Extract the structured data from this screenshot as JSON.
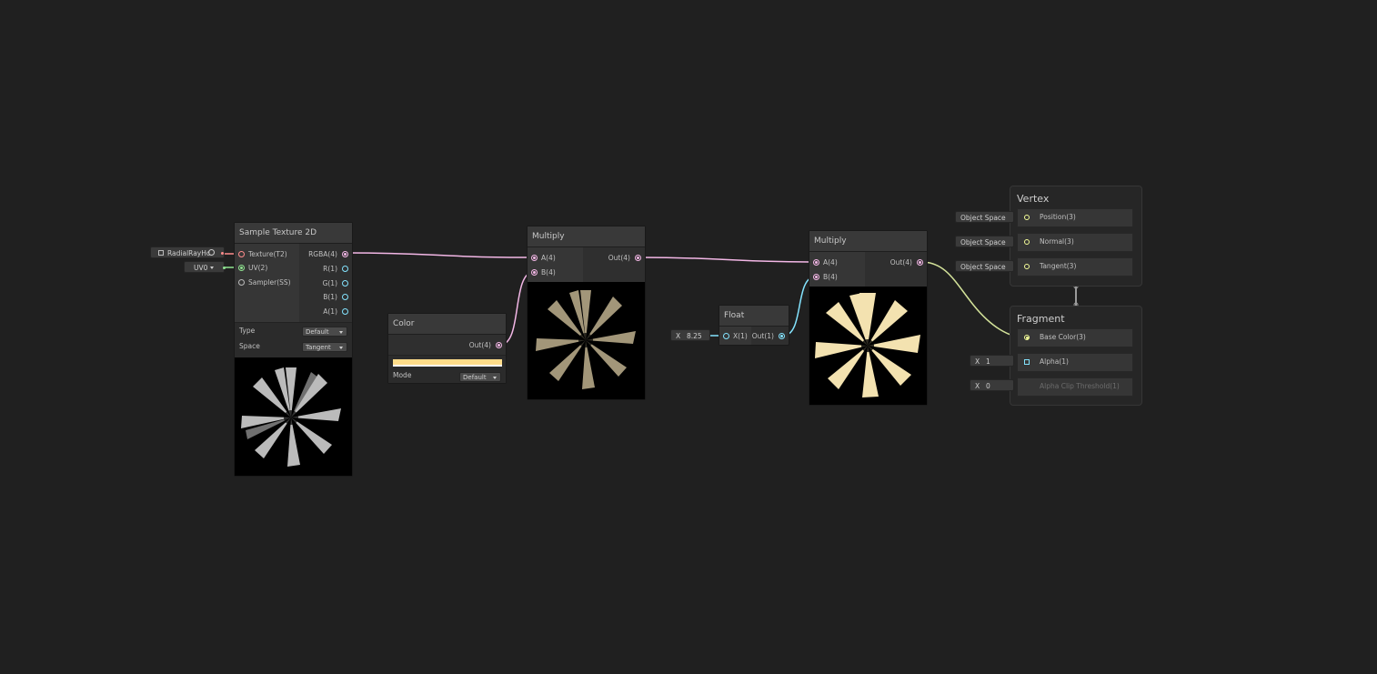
{
  "colors": {
    "background": "#202020",
    "vector4_port": "#f3b7e6",
    "texture_port": "#ff8c8c",
    "uv_port": "#8fe390",
    "float_port": "#84e4ff",
    "vector3_port": "#f6ff9a",
    "color_swatch": "#ffdd8a"
  },
  "sample_texture": {
    "title": "Sample Texture 2D",
    "texture_ref": "RadialRayHc",
    "uv_channel": "UV0",
    "inputs": [
      "Texture(T2)",
      "UV(2)",
      "Sampler(SS)"
    ],
    "outputs": [
      "RGBA(4)",
      "R(1)",
      "G(1)",
      "B(1)",
      "A(1)"
    ],
    "type_label": "Type",
    "type_value": "Default",
    "space_label": "Space",
    "space_value": "Tangent"
  },
  "color_node": {
    "title": "Color",
    "output": "Out(4)",
    "mode_label": "Mode",
    "mode_value": "Default"
  },
  "multiply1": {
    "title": "Multiply",
    "input_a": "A(4)",
    "input_b": "B(4)",
    "output": "Out(4)"
  },
  "float_node": {
    "title": "Float",
    "x_label": "X",
    "x_value": "8.25",
    "input": "X(1)",
    "output": "Out(1)"
  },
  "multiply2": {
    "title": "Multiply",
    "input_a": "A(4)",
    "input_b": "B(4)",
    "output": "Out(4)"
  },
  "vertex": {
    "title": "Vertex",
    "blocks": [
      {
        "label": "Position(3)",
        "space": "Object Space"
      },
      {
        "label": "Normal(3)",
        "space": "Object Space"
      },
      {
        "label": "Tangent(3)",
        "space": "Object Space"
      }
    ]
  },
  "fragment": {
    "title": "Fragment",
    "blocks": [
      {
        "label": "Base Color(3)"
      },
      {
        "label": "Alpha(1)",
        "x_label": "X",
        "value": "1"
      },
      {
        "label": "Alpha Clip Threshold(1)",
        "x_label": "X",
        "value": "0"
      }
    ]
  },
  "icons": [
    "texture-asset-icon",
    "object-picker-icon",
    "dropdown-arrow-icon",
    "port-icon"
  ]
}
